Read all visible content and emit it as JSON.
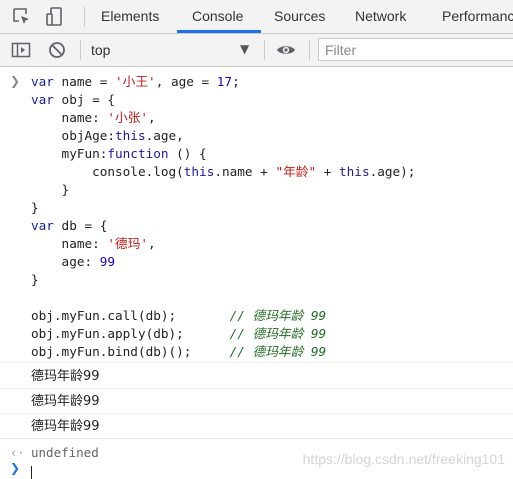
{
  "tabs": [
    {
      "label": "Elements",
      "active": false
    },
    {
      "label": "Console",
      "active": true
    },
    {
      "label": "Sources",
      "active": false
    },
    {
      "label": "Network",
      "active": false
    },
    {
      "label": "Performance",
      "active": false
    }
  ],
  "toolbar": {
    "context": "top",
    "filter_placeholder": "Filter"
  },
  "code": {
    "lines": [
      "var name = '小王', age = 17;",
      "var obj = {",
      "    name: '小张',",
      "    objAge:this.age,",
      "    myFun:function () {",
      "        console.log(this.name + \"年龄\" + this.age);",
      "    }",
      "}",
      "var db = {",
      "    name: '德玛',",
      "    age: 99",
      "}",
      "",
      "obj.myFun.call(db);       // 德玛年龄 99",
      "obj.myFun.apply(db);      // 德玛年龄 99",
      "obj.myFun.bind(db)();     // 德玛年龄 99"
    ]
  },
  "outputs": [
    "德玛年龄99",
    "德玛年龄99",
    "德玛年龄99"
  ],
  "result": "undefined",
  "watermark": "https://blog.csdn.net/freeking101",
  "colors": {
    "keyword": "#1a1aa6",
    "string": "#c41a16",
    "number": "#1c00cf",
    "comment": "#236e25",
    "tab_underline": "#1a73e8"
  },
  "icons": [
    "inspect-element-icon",
    "device-toolbar-icon",
    "sidebar-toggle-icon",
    "clear-console-icon",
    "eye-icon",
    "dropdown-arrow-icon",
    "prompt-chevron-icon",
    "result-arrow-icon"
  ]
}
